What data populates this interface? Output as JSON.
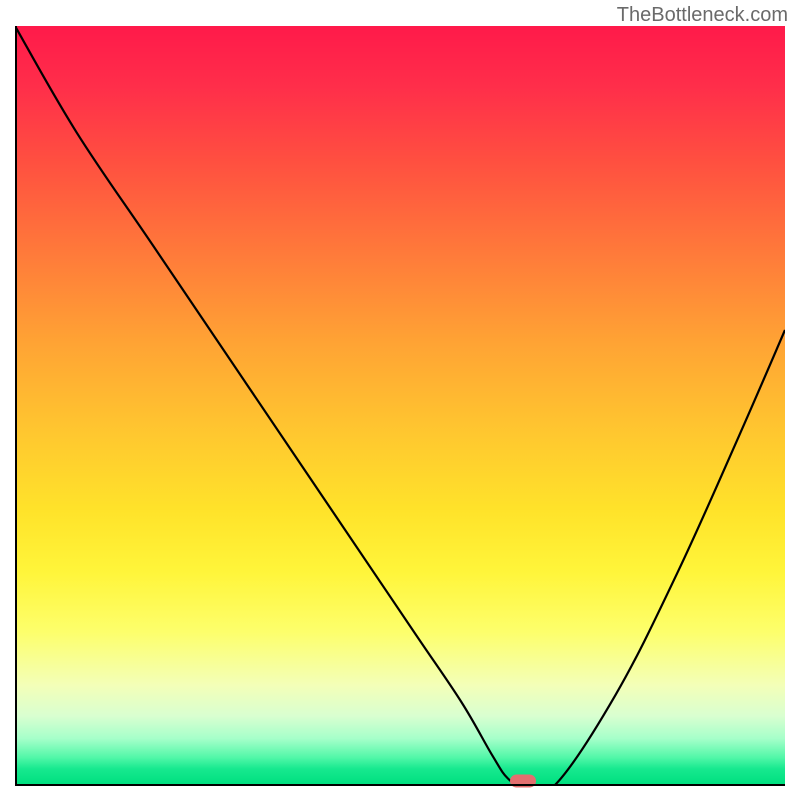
{
  "watermark": "TheBottleneck.com",
  "chart_data": {
    "type": "line",
    "title": "",
    "xlabel": "",
    "ylabel": "",
    "xlim": [
      0,
      100
    ],
    "ylim": [
      0,
      100
    ],
    "x": [
      0,
      8,
      18,
      30,
      42,
      52,
      58,
      62,
      64,
      66,
      70,
      78,
      86,
      94,
      100
    ],
    "values": [
      100,
      86,
      71,
      53,
      35,
      20,
      11,
      4,
      1,
      0,
      0,
      12,
      28,
      46,
      60
    ],
    "marker": {
      "x": 66,
      "y": 0,
      "color": "#e36f6f"
    },
    "gradient_stops": [
      {
        "pos": 0,
        "color": "#ff1a4a"
      },
      {
        "pos": 50,
        "color": "#ffc82f"
      },
      {
        "pos": 80,
        "color": "#fdff6c"
      },
      {
        "pos": 100,
        "color": "#00e080"
      }
    ]
  }
}
